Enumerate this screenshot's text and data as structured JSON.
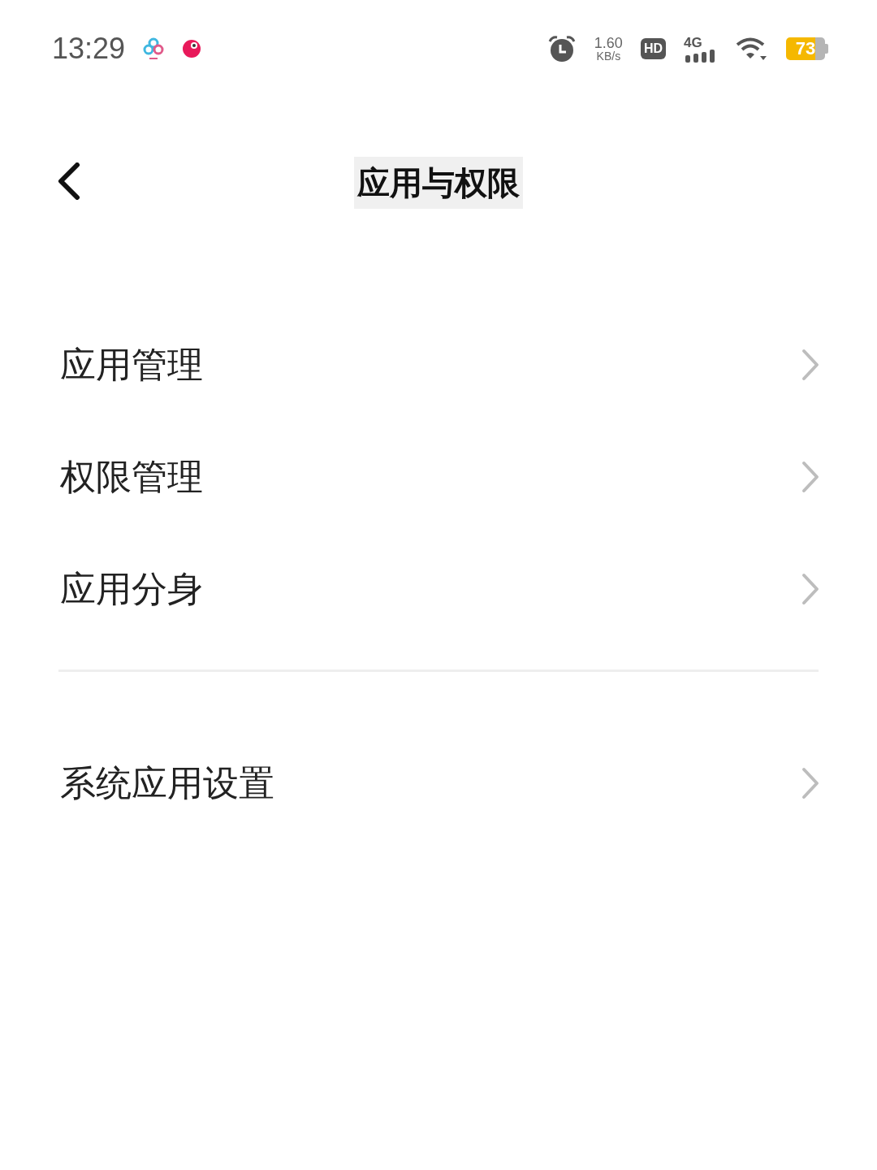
{
  "status_bar": {
    "time": "13:29",
    "speed_value": "1.60",
    "speed_unit": "KB/s",
    "hd_badge": "HD",
    "network": "4G",
    "battery": "73"
  },
  "header": {
    "title": "应用与权限"
  },
  "groups": [
    {
      "items": [
        {
          "label": "应用管理"
        },
        {
          "label": "权限管理"
        },
        {
          "label": "应用分身"
        }
      ]
    },
    {
      "items": [
        {
          "label": "系统应用设置"
        }
      ]
    }
  ]
}
